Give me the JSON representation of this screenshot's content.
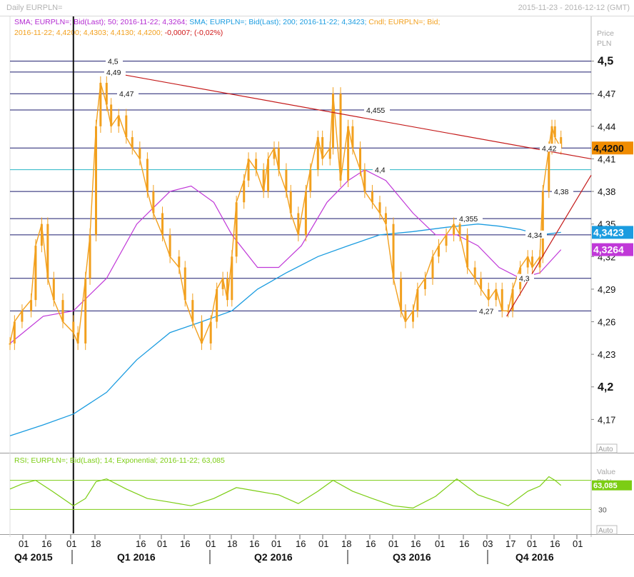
{
  "header": {
    "title": "Daily EURPLN=",
    "date_range": "2015-11-23 - 2016-12-12 (GMT)"
  },
  "legend": {
    "line1": [
      {
        "text": "SMA; EURPLN=; Bid(Last);  50;  2016-11-22;  4,3264;",
        "color": "#b42bd2"
      },
      {
        "text": " SMA; EURPLN=; Bid(Last);  200;  2016-11-22;  4,3423;",
        "color": "#1b9ce0"
      },
      {
        "text": " Cndl; EURPLN=; Bid;",
        "color": "#f2a01e"
      }
    ],
    "line2": [
      {
        "text": "2016-11-22;  4,4200;  4,4303;  4,4130;  4,4200;",
        "color": "#f2a01e"
      },
      {
        "text": "  -0,0007;  (-0,02%)",
        "color": "#d01818"
      }
    ]
  },
  "price_axis": {
    "title_top": "Price",
    "title_bottom": "PLN",
    "auto_label": "Auto"
  },
  "rsi_panel": {
    "legend": "RSI; EURPLN=; Bid(Last);  14;  Exponential;  2016-11-22;  63,085",
    "axis_title_top": "Value",
    "axis_title_bottom": "PLN",
    "tick_label": "30",
    "auto_label": "Auto"
  },
  "colors": {
    "candle": "#f2a01e",
    "sma50": "#c038d8",
    "sma200": "#1b9ce0",
    "rsi": "#7ccd14",
    "level_line": "#1b1b6e",
    "trend_line": "#c41a1a",
    "cyan_line": "#27b5c4"
  },
  "chart_data": {
    "type": "candlestick",
    "title": "Daily EURPLN=",
    "date_range": [
      "2015-11-23",
      "2016-12-12"
    ],
    "y_axis": {
      "title": "Price PLN",
      "range": [
        4.14,
        4.53
      ],
      "ticks": [
        "4,5",
        "4,47",
        "4,44",
        "4,41",
        "4,38",
        "4,35",
        "4,32",
        "4,29",
        "4,26",
        "4,23",
        "4,2",
        "4,17"
      ],
      "tick_values": [
        4.5,
        4.47,
        4.44,
        4.41,
        4.38,
        4.35,
        4.32,
        4.29,
        4.26,
        4.23,
        4.2,
        4.17
      ],
      "bold_ticks": [
        "4,5",
        "4,2"
      ]
    },
    "x_axis": {
      "day_ticks": [
        "01",
        "16",
        "01",
        "18",
        "16",
        "01",
        "16",
        "01",
        "18",
        "16",
        "01",
        "16",
        "01",
        "18",
        "16",
        "01",
        "16",
        "03",
        "17",
        "01",
        "16",
        "01"
      ],
      "quarters": [
        "Q4 2015",
        "Q1 2016",
        "Q2 2016",
        "Q3 2016",
        "Q4 2016"
      ]
    },
    "horizontal_levels": [
      {
        "value": 4.5,
        "label": "4,5"
      },
      {
        "value": 4.49,
        "label": "4,49"
      },
      {
        "value": 4.47,
        "label": "4,47"
      },
      {
        "value": 4.455,
        "label": "4,455"
      },
      {
        "value": 4.42,
        "label": "4,42"
      },
      {
        "value": 4.4,
        "label": "4,4"
      },
      {
        "value": 4.38,
        "label": "4,38"
      },
      {
        "value": 4.355,
        "label": "4,355"
      },
      {
        "value": 4.34,
        "label": "4,34"
      },
      {
        "value": 4.3,
        "label": "4,3"
      },
      {
        "value": 4.27,
        "label": "4,27"
      }
    ],
    "value_tags": [
      {
        "label": "4,4200",
        "value": 4.42,
        "series": "EURPLN= Bid (last close)",
        "color": "#f08c00"
      },
      {
        "label": "4,3423",
        "value": 4.3423,
        "series": "SMA 200",
        "color": "#1b9ce0"
      },
      {
        "label": "4,3264",
        "value": 4.3264,
        "series": "SMA 50",
        "color": "#c038d8"
      }
    ],
    "last_candle": {
      "date": "2016-11-22",
      "open": 4.42,
      "high": 4.4303,
      "low": 4.413,
      "close": 4.42,
      "change": -0.0007,
      "change_pct": "-0,02%"
    },
    "price_series": {
      "name": "Cndl; EURPLN=; Bid",
      "points": [
        [
          "2015-11-23",
          4.24
        ],
        [
          "2015-11-26",
          4.26
        ],
        [
          "2015-12-01",
          4.27
        ],
        [
          "2015-12-07",
          4.28
        ],
        [
          "2015-12-10",
          4.33
        ],
        [
          "2015-12-14",
          4.35
        ],
        [
          "2015-12-18",
          4.3
        ],
        [
          "2015-12-22",
          4.28
        ],
        [
          "2015-12-28",
          4.26
        ],
        [
          "2016-01-04",
          4.25
        ],
        [
          "2016-01-07",
          4.24
        ],
        [
          "2016-01-12",
          4.3
        ],
        [
          "2016-01-15",
          4.34
        ],
        [
          "2016-01-19",
          4.44
        ],
        [
          "2016-01-22",
          4.48
        ],
        [
          "2016-01-26",
          4.46
        ],
        [
          "2016-01-29",
          4.44
        ],
        [
          "2016-02-03",
          4.45
        ],
        [
          "2016-02-08",
          4.43
        ],
        [
          "2016-02-12",
          4.42
        ],
        [
          "2016-02-17",
          4.41
        ],
        [
          "2016-02-22",
          4.38
        ],
        [
          "2016-02-26",
          4.36
        ],
        [
          "2016-03-03",
          4.34
        ],
        [
          "2016-03-08",
          4.32
        ],
        [
          "2016-03-14",
          4.31
        ],
        [
          "2016-03-18",
          4.28
        ],
        [
          "2016-03-23",
          4.26
        ],
        [
          "2016-03-29",
          4.24
        ],
        [
          "2016-04-04",
          4.26
        ],
        [
          "2016-04-08",
          4.29
        ],
        [
          "2016-04-12",
          4.3
        ],
        [
          "2016-04-15",
          4.28
        ],
        [
          "2016-04-18",
          4.32
        ],
        [
          "2016-04-21",
          4.37
        ],
        [
          "2016-04-26",
          4.39
        ],
        [
          "2016-04-29",
          4.41
        ],
        [
          "2016-05-04",
          4.4
        ],
        [
          "2016-05-09",
          4.38
        ],
        [
          "2016-05-12",
          4.41
        ],
        [
          "2016-05-16",
          4.42
        ],
        [
          "2016-05-19",
          4.4
        ],
        [
          "2016-05-24",
          4.38
        ],
        [
          "2016-05-27",
          4.36
        ],
        [
          "2016-06-01",
          4.34
        ],
        [
          "2016-06-06",
          4.38
        ],
        [
          "2016-06-09",
          4.4
        ],
        [
          "2016-06-14",
          4.43
        ],
        [
          "2016-06-17",
          4.41
        ],
        [
          "2016-06-22",
          4.42
        ],
        [
          "2016-06-24",
          4.47
        ],
        [
          "2016-06-29",
          4.39
        ],
        [
          "2016-07-04",
          4.44
        ],
        [
          "2016-07-07",
          4.42
        ],
        [
          "2016-07-12",
          4.4
        ],
        [
          "2016-07-15",
          4.38
        ],
        [
          "2016-07-20",
          4.37
        ],
        [
          "2016-07-25",
          4.36
        ],
        [
          "2016-07-29",
          4.35
        ],
        [
          "2016-08-03",
          4.3
        ],
        [
          "2016-08-08",
          4.27
        ],
        [
          "2016-08-11",
          4.26
        ],
        [
          "2016-08-16",
          4.27
        ],
        [
          "2016-08-19",
          4.29
        ],
        [
          "2016-08-24",
          4.3
        ],
        [
          "2016-08-29",
          4.32
        ],
        [
          "2016-09-02",
          4.33
        ],
        [
          "2016-09-07",
          4.34
        ],
        [
          "2016-09-12",
          4.35
        ],
        [
          "2016-09-16",
          4.34
        ],
        [
          "2016-09-21",
          4.31
        ],
        [
          "2016-09-26",
          4.3
        ],
        [
          "2016-09-30",
          4.29
        ],
        [
          "2016-10-05",
          4.28
        ],
        [
          "2016-10-10",
          4.29
        ],
        [
          "2016-10-14",
          4.27
        ],
        [
          "2016-10-18",
          4.27
        ],
        [
          "2016-10-21",
          4.29
        ],
        [
          "2016-10-26",
          4.31
        ],
        [
          "2016-10-31",
          4.32
        ],
        [
          "2016-11-03",
          4.31
        ],
        [
          "2016-11-08",
          4.32
        ],
        [
          "2016-11-10",
          4.38
        ],
        [
          "2016-11-14",
          4.42
        ],
        [
          "2016-11-16",
          4.44
        ],
        [
          "2016-11-18",
          4.43
        ],
        [
          "2016-11-22",
          4.42
        ]
      ]
    },
    "sma50": {
      "name": "SMA; EURPLN=; Bid(Last); 50",
      "points": [
        [
          "2015-11-23",
          4.24
        ],
        [
          "2015-12-15",
          4.265
        ],
        [
          "2016-01-04",
          4.27
        ],
        [
          "2016-01-26",
          4.3
        ],
        [
          "2016-02-15",
          4.35
        ],
        [
          "2016-03-08",
          4.38
        ],
        [
          "2016-03-22",
          4.385
        ],
        [
          "2016-04-06",
          4.37
        ],
        [
          "2016-04-18",
          4.34
        ],
        [
          "2016-05-05",
          4.31
        ],
        [
          "2016-05-19",
          4.31
        ],
        [
          "2016-06-03",
          4.33
        ],
        [
          "2016-06-20",
          4.37
        ],
        [
          "2016-07-04",
          4.39
        ],
        [
          "2016-07-15",
          4.4
        ],
        [
          "2016-07-29",
          4.39
        ],
        [
          "2016-08-16",
          4.36
        ],
        [
          "2016-08-31",
          4.34
        ],
        [
          "2016-09-14",
          4.34
        ],
        [
          "2016-09-28",
          4.33
        ],
        [
          "2016-10-12",
          4.31
        ],
        [
          "2016-10-26",
          4.3
        ],
        [
          "2016-11-08",
          4.305
        ],
        [
          "2016-11-22",
          4.3264
        ]
      ]
    },
    "sma200": {
      "name": "SMA; EURPLN=; Bid(Last); 200",
      "points": [
        [
          "2015-11-23",
          4.155
        ],
        [
          "2015-12-15",
          4.165
        ],
        [
          "2016-01-04",
          4.175
        ],
        [
          "2016-01-26",
          4.195
        ],
        [
          "2016-02-15",
          4.225
        ],
        [
          "2016-03-08",
          4.25
        ],
        [
          "2016-03-29",
          4.26
        ],
        [
          "2016-04-18",
          4.27
        ],
        [
          "2016-05-05",
          4.29
        ],
        [
          "2016-05-24",
          4.305
        ],
        [
          "2016-06-14",
          4.32
        ],
        [
          "2016-07-04",
          4.33
        ],
        [
          "2016-07-25",
          4.34
        ],
        [
          "2016-08-16",
          4.343
        ],
        [
          "2016-09-07",
          4.347
        ],
        [
          "2016-09-28",
          4.35
        ],
        [
          "2016-10-12",
          4.348
        ],
        [
          "2016-10-26",
          4.345
        ],
        [
          "2016-11-08",
          4.34
        ],
        [
          "2016-11-22",
          4.3423
        ]
      ]
    },
    "trend_lines": [
      {
        "from": [
          "2016-01-27",
          4.49
        ],
        "to": [
          "2016-12-12",
          4.41
        ],
        "color": "#c41a1a"
      },
      {
        "from": [
          "2016-10-17",
          4.265
        ],
        "to": [
          "2016-12-12",
          4.395
        ],
        "color": "#c41a1a"
      }
    ],
    "rsi": {
      "name": "RSI; EURPLN=; Bid(Last); 14; Exponential",
      "last_value": 63.085,
      "last_label": "63,085",
      "levels": [
        70,
        30
      ],
      "points": [
        [
          "2015-11-23",
          58
        ],
        [
          "2015-12-01",
          65
        ],
        [
          "2015-12-10",
          70
        ],
        [
          "2015-12-21",
          55
        ],
        [
          "2016-01-04",
          35
        ],
        [
          "2016-01-12",
          45
        ],
        [
          "2016-01-19",
          68
        ],
        [
          "2016-01-26",
          72
        ],
        [
          "2016-02-08",
          58
        ],
        [
          "2016-02-22",
          45
        ],
        [
          "2016-03-08",
          40
        ],
        [
          "2016-03-22",
          35
        ],
        [
          "2016-04-06",
          45
        ],
        [
          "2016-04-21",
          60
        ],
        [
          "2016-05-05",
          55
        ],
        [
          "2016-05-19",
          50
        ],
        [
          "2016-06-01",
          38
        ],
        [
          "2016-06-14",
          55
        ],
        [
          "2016-06-24",
          70
        ],
        [
          "2016-07-07",
          55
        ],
        [
          "2016-07-20",
          45
        ],
        [
          "2016-08-03",
          35
        ],
        [
          "2016-08-16",
          32
        ],
        [
          "2016-08-31",
          48
        ],
        [
          "2016-09-14",
          72
        ],
        [
          "2016-09-28",
          50
        ],
        [
          "2016-10-12",
          40
        ],
        [
          "2016-10-18",
          35
        ],
        [
          "2016-10-31",
          55
        ],
        [
          "2016-11-08",
          62
        ],
        [
          "2016-11-14",
          75
        ],
        [
          "2016-11-18",
          70
        ],
        [
          "2016-11-22",
          63.085
        ]
      ]
    }
  }
}
